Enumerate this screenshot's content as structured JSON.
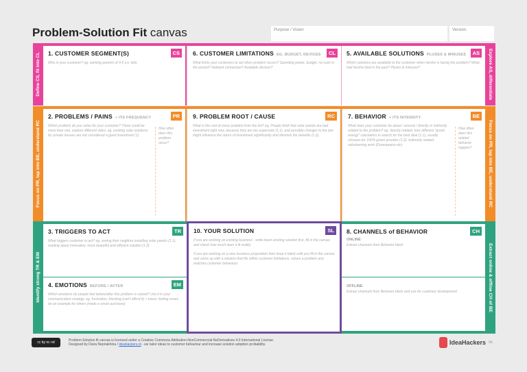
{
  "header": {
    "title_bold": "Problem-Solution Fit",
    "title_light": "canvas",
    "purpose_label": "Purpose / Vision",
    "version_label": "Version."
  },
  "strips": {
    "left_pink": "Define CS, fit into CL",
    "right_pink": "Explore AS, differentiate",
    "left_orange": "Focus on PR, tap into BE, understand RC",
    "right_orange": "Focus on PR, tap into BE, understand RC",
    "left_green": "Identify strong TR & EM",
    "right_green": "Extract online & offline CH of BE"
  },
  "colors": {
    "pink": "#e8439a",
    "orange": "#f28c28",
    "green": "#2fa37f",
    "purple": "#6e4a9e"
  },
  "blocks": {
    "cs": {
      "title": "1. CUSTOMER SEGMENT(S)",
      "tag": "CS",
      "hint": "Who is your customer? eg. working parents of 0-5 y.o. kids"
    },
    "cl": {
      "title": "6. CUSTOMER LIMITATIONS",
      "note": "EG. BUDGET, DEVICES",
      "tag": "CL",
      "hint": "What limits your customers to act when problem occurs? Spending power, budget, no cash in the pocket? Network connection? Available devices?"
    },
    "as": {
      "title": "5. AVAILABLE SOLUTIONS",
      "note": "PLUSES & MINUSES",
      "tag": "AS",
      "hint": "Which solutions are available to the customer when he/she is facing the problem? What had he/she tried in the past? Pluses & minuses?"
    },
    "pr": {
      "title": "2. PROBLEMS / PAINS",
      "note": "+ ITS FREQUENCY",
      "tag": "PR",
      "hint": "Which problem do you solve for your customer? There could be more than one, explore different sides. eg. existing solar solutions for private houses are not considered a good investment (1).",
      "side": "How often does this problem occur?"
    },
    "rc": {
      "title": "9. PROBLEM ROOT / CAUSE",
      "tag": "RC",
      "hint": "What is the root of every problem from the list? eg. People think that solar panels are bad investment right now, because they are too expensive (1.1), and possible changes to the law might influence the return of investment significantly and diminish the benefits (1.2)."
    },
    "be": {
      "title": "7. BEHAVIOR",
      "note": "+ ITS INTENSITY",
      "tag": "BE",
      "hint": "What does your customer do about / around / directly or indirectly related to the problem? eg. directly related: tries different \"green energy\" calculators in search for the best deal (1.1), usually chooses for 100% green provider (1.2). Indirectly related: volunteering work (Greenpeace etc)",
      "side": "How often does this related behavior happen?"
    },
    "tr": {
      "title": "3. TRIGGERS TO ACT",
      "tag": "TR",
      "hint": "What triggers customer to act? eg. seeing their neighbor installing solar panels (1.1), reading about innovative, more beautiful and efficient solution (1.2)"
    },
    "em": {
      "title": "4. EMOTIONS",
      "note": "BEFORE / AFTER",
      "tag": "EM",
      "hint": "Which emotions do people feel before/after this problem is solved? Use it in your communication strategy. eg. frustration, blocking (can't afford it) > boost, feeling smart, be an example for others (made a smart purchase)"
    },
    "sl": {
      "title": "10. YOUR SOLUTION",
      "tag": "SL",
      "hint1": "If you are working on existing business - write down existing solution first, fill in the canvas and check how much does it fit reality.",
      "hint2": "If you are working on a new business proposition then keep it blank until you fill in the canvas and come up with a solution that fits within customer limitations, solves a problem and matches customer behaviour."
    },
    "ch": {
      "title": "8. CHANNELS of BEHAVIOR",
      "tag": "CH",
      "online": "ONLINE",
      "online_hint": "Extract channels from Behavior block",
      "offline": "OFFLINE",
      "offline_hint": "Extract channels from Behavior block and use for customer development"
    }
  },
  "footer": {
    "line1": "Problem-Solution fit canvas is licensed under a Creative Commons Attribution-NonCommercial-NoDerivatives 4.0 International License.",
    "line2_a": "Designed by Daria Nepriakhina /",
    "link": "ideahackers.nl",
    "line2_b": "- we tailor ideas to customer behaviour and increase solution adoption probability.",
    "brand": "IdeaHackers",
    "brand_suffix": ".NL",
    "cc": "cc by nc nd"
  }
}
